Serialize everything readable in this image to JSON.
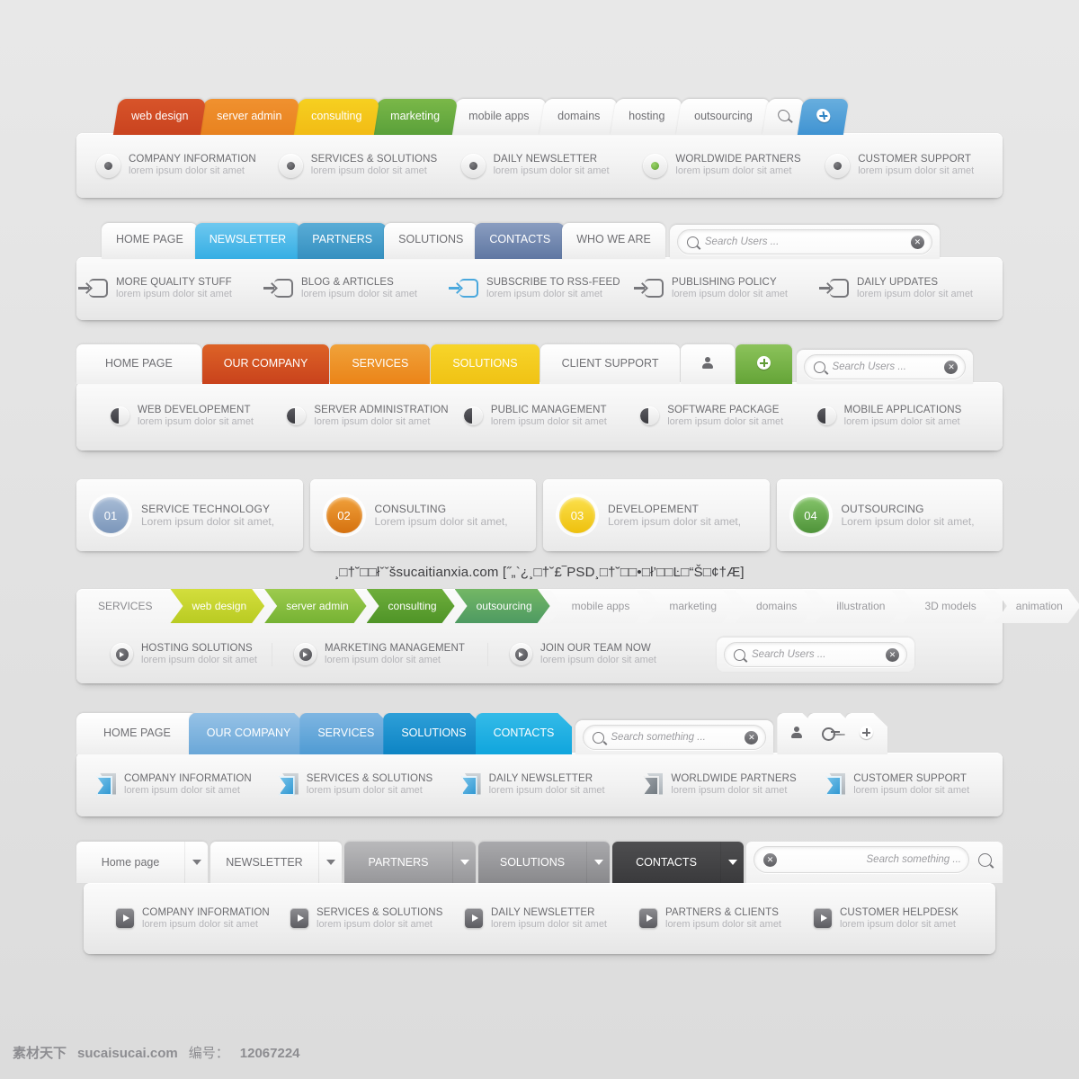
{
  "section1": {
    "tabs": [
      {
        "label": "web design",
        "style": "c1"
      },
      {
        "label": "server admin",
        "style": "c2"
      },
      {
        "label": "consulting",
        "style": "c3"
      },
      {
        "label": "marketing",
        "style": "c4"
      },
      {
        "label": "mobile apps",
        "style": "plain"
      },
      {
        "label": "domains",
        "style": "plain"
      },
      {
        "label": "hosting",
        "style": "plain"
      },
      {
        "label": "outsourcing",
        "style": "plain"
      }
    ],
    "search_icon": "search-icon",
    "add_icon": "plus-icon",
    "features": [
      {
        "title": "COMPANY INFORMATION",
        "sub": "lorem ipsum dolor sit amet",
        "dot": "grey"
      },
      {
        "title": "SERVICES & SOLUTIONS",
        "sub": "lorem ipsum dolor sit amet",
        "dot": "grey"
      },
      {
        "title": "DAILY NEWSLETTER",
        "sub": "lorem ipsum dolor sit amet",
        "dot": "grey"
      },
      {
        "title": "WORLDWIDE PARTNERS",
        "sub": "lorem ipsum dolor sit amet",
        "dot": "green"
      },
      {
        "title": "CUSTOMER SUPPORT",
        "sub": "lorem ipsum dolor sit amet",
        "dot": "grey"
      }
    ]
  },
  "section2": {
    "tabs": [
      {
        "label": "HOME PAGE",
        "style": "plain"
      },
      {
        "label": "NEWSLETTER",
        "style": "b1"
      },
      {
        "label": "PARTNERS",
        "style": "b2"
      },
      {
        "label": "SOLUTIONS",
        "style": "plain"
      },
      {
        "label": "CONTACTS",
        "style": "b3"
      },
      {
        "label": "WHO WE ARE",
        "style": "plain"
      }
    ],
    "search": {
      "placeholder": "Search Users ...",
      "clear": "✕"
    },
    "features": [
      {
        "title": "MORE QUALITY STUFF",
        "sub": "lorem ipsum dolor sit amet",
        "accent": "grey"
      },
      {
        "title": "BLOG & ARTICLES",
        "sub": "lorem ipsum dolor sit amet",
        "accent": "grey"
      },
      {
        "title": "SUBSCRIBE TO RSS-FEED",
        "sub": "lorem ipsum dolor sit amet",
        "accent": "blue"
      },
      {
        "title": "PUBLISHING POLICY",
        "sub": "lorem ipsum dolor sit amet",
        "accent": "grey"
      },
      {
        "title": "DAILY UPDATES",
        "sub": "lorem ipsum dolor sit amet",
        "accent": "grey"
      }
    ]
  },
  "section3": {
    "tabs": [
      {
        "label": "HOME PAGE",
        "style": "plain"
      },
      {
        "label": "OUR COMPANY",
        "style": "o1"
      },
      {
        "label": "SERVICES",
        "style": "o2"
      },
      {
        "label": "SOLUTIONS",
        "style": "o3"
      },
      {
        "label": "CLIENT SUPPORT",
        "style": "plain"
      }
    ],
    "user_icon": "user-icon",
    "add_icon": "plus-icon",
    "search": {
      "placeholder": "Search Users ...",
      "clear": "✕"
    },
    "features": [
      {
        "title": "WEB DEVELOPEMENT",
        "sub": "lorem ipsum dolor sit amet"
      },
      {
        "title": "SERVER ADMINISTRATION",
        "sub": "lorem ipsum dolor sit amet"
      },
      {
        "title": "PUBLIC MANAGEMENT",
        "sub": "lorem ipsum dolor sit amet"
      },
      {
        "title": "SOFTWARE PACKAGE",
        "sub": "lorem ipsum dolor sit amet"
      },
      {
        "title": "MOBILE APPLICATIONS",
        "sub": "lorem ipsum dolor sit amet"
      }
    ]
  },
  "section4": {
    "cards": [
      {
        "num": "01",
        "title": "SERVICE TECHNOLOGY",
        "sub": "Lorem ipsum dolor sit amet,",
        "color": "#8ba4c4"
      },
      {
        "num": "02",
        "title": "CONSULTING",
        "sub": "Lorem ipsum dolor sit amet,",
        "color": "#e0801f"
      },
      {
        "num": "03",
        "title": "DEVELOPEMENT",
        "sub": "Lorem ipsum dolor sit amet,",
        "color": "#f3cc1b"
      },
      {
        "num": "04",
        "title": "OUTSOURCING",
        "sub": "Lorem ipsum dolor sit amet,",
        "color": "#63a94a"
      }
    ]
  },
  "watermark": "¸□†˘□□łˇˇšsucaitianxia.com [˝„`¿¸□†˘£‾PSD¸□†˘□□•□ł’□□Ŀ□“Š□¢†Æ]",
  "section5": {
    "crumbs": [
      {
        "label": "SERVICES",
        "style": "first"
      },
      {
        "label": "web design",
        "style": "g1"
      },
      {
        "label": "server admin",
        "style": "g2"
      },
      {
        "label": "consulting",
        "style": "g3"
      },
      {
        "label": "outsourcing",
        "style": "g4"
      },
      {
        "label": "mobile apps",
        "style": "pl"
      },
      {
        "label": "marketing",
        "style": "pl"
      },
      {
        "label": "domains",
        "style": "pl"
      },
      {
        "label": "illustration",
        "style": "pl"
      },
      {
        "label": "3D models",
        "style": "pl"
      },
      {
        "label": "animation",
        "style": "pl"
      }
    ],
    "search": {
      "placeholder": "Search Users ...",
      "clear": "✕"
    },
    "features": [
      {
        "title": "HOSTING SOLUTIONS",
        "sub": "lorem ipsum dolor sit amet"
      },
      {
        "title": "MARKETING MANAGEMENT",
        "sub": "lorem ipsum dolor sit amet"
      },
      {
        "title": "JOIN OUR TEAM NOW",
        "sub": "lorem ipsum dolor sit amet"
      }
    ]
  },
  "section6": {
    "tabs": [
      {
        "label": "HOME PAGE",
        "style": "first"
      },
      {
        "label": "OUR COMPANY",
        "style": "k1"
      },
      {
        "label": "SERVICES",
        "style": "k2"
      },
      {
        "label": "SOLUTIONS",
        "style": "k3"
      },
      {
        "label": "CONTACTS",
        "style": "k4"
      }
    ],
    "search": {
      "placeholder": "Search something ...",
      "clear": "✕"
    },
    "user_icon": "user-icon",
    "key_icon": "key-icon",
    "add_icon": "plus-icon",
    "features": [
      {
        "title": "COMPANY INFORMATION",
        "sub": "lorem ipsum dolor sit amet",
        "accent": "blue"
      },
      {
        "title": "SERVICES & SOLUTIONS",
        "sub": "lorem ipsum dolor sit amet",
        "accent": "blue"
      },
      {
        "title": "DAILY NEWSLETTER",
        "sub": "lorem ipsum dolor sit amet",
        "accent": "blue"
      },
      {
        "title": "WORLDWIDE PARTNERS",
        "sub": "lorem ipsum dolor sit amet",
        "accent": "grey"
      },
      {
        "title": "CUSTOMER SUPPORT",
        "sub": "lorem ipsum dolor sit amet",
        "accent": "blue"
      }
    ]
  },
  "section7": {
    "tabs": [
      {
        "label": "Home page",
        "style": "plain"
      },
      {
        "label": "NEWSLETTER",
        "style": "plain"
      },
      {
        "label": "PARTNERS",
        "style": "d1"
      },
      {
        "label": "SOLUTIONS",
        "style": "d2"
      },
      {
        "label": "CONTACTS",
        "style": "d3"
      }
    ],
    "search": {
      "placeholder": "Search something ...",
      "clear": "✕"
    },
    "features": [
      {
        "title": "COMPANY INFORMATION",
        "sub": "lorem ipsum dolor sit amet"
      },
      {
        "title": "SERVICES & SOLUTIONS",
        "sub": "lorem ipsum dolor sit amet"
      },
      {
        "title": "DAILY NEWSLETTER",
        "sub": "lorem ipsum dolor sit amet"
      },
      {
        "title": "PARTNERS & CLIENTS",
        "sub": "lorem ipsum dolor sit amet"
      },
      {
        "title": "CUSTOMER HELPDESK",
        "sub": "lorem ipsum dolor sit amet"
      }
    ]
  },
  "footer": {
    "brand": "素材天下",
    "site": "sucaisucai.com",
    "id_label": "编号：",
    "id_value": "12067224"
  }
}
